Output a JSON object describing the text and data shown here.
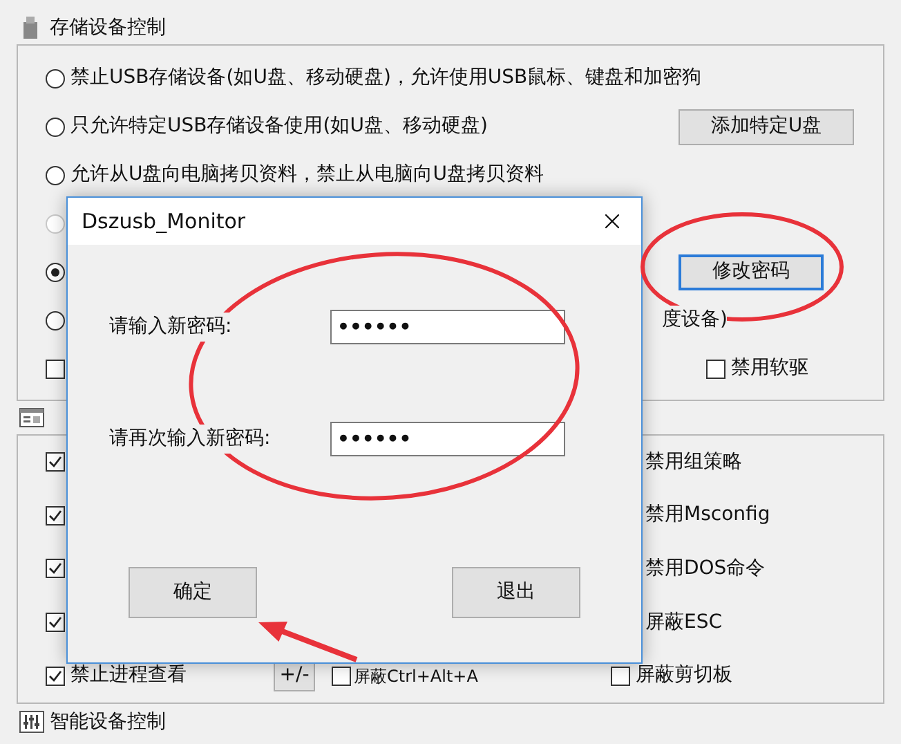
{
  "storage": {
    "title": "存储设备控制",
    "rows": [
      {
        "kind": "radio",
        "label": "禁止USB存储设备(如U盘、移动硬盘)，允许使用USB鼠标、键盘和加密狗",
        "selected": false,
        "disabled": false
      },
      {
        "kind": "radio",
        "label": "只允许特定USB存储设备使用(如U盘、移动硬盘)",
        "selected": false,
        "disabled": false,
        "button": "添加特定U盘"
      },
      {
        "kind": "radio",
        "label": "允许从U盘向电脑拷贝资料，禁止从电脑向U盘拷贝资料",
        "selected": false,
        "disabled": false
      },
      {
        "kind": "radio",
        "selected": false,
        "disabled": true
      },
      {
        "kind": "radio",
        "selected": true,
        "disabled": false,
        "button": "修改密码"
      },
      {
        "kind": "radio",
        "selected": false,
        "disabled": false,
        "tail": "度设备)"
      },
      {
        "kind": "checkbox",
        "checked": false,
        "extra": {
          "label": "禁用软驱",
          "checked": false
        }
      }
    ]
  },
  "system": {
    "rows": [
      {
        "checked": true,
        "right": {
          "label": "禁用组策略"
        }
      },
      {
        "checked": true,
        "right": {
          "label": "禁用Msconfig"
        }
      },
      {
        "checked": true,
        "right": {
          "label": "禁用DOS命令"
        }
      },
      {
        "checked": true,
        "right": {
          "label": "屏蔽ESC"
        }
      },
      {
        "checked": true,
        "label": "禁止进程查看",
        "button": "+/-",
        "middle": {
          "label": "屏蔽Ctrl+Alt+A",
          "checked": false
        },
        "right": {
          "label": "屏蔽剪切板",
          "checked": false
        }
      }
    ]
  },
  "smart": {
    "title": "智能设备控制"
  },
  "dialog": {
    "title": "Dszusb_Monitor",
    "fields": [
      {
        "label": "请输入新密码:",
        "value": "••••••"
      },
      {
        "label": "请再次输入新密码:",
        "value": "••••••"
      }
    ],
    "buttons": [
      "确定",
      "退出"
    ]
  }
}
